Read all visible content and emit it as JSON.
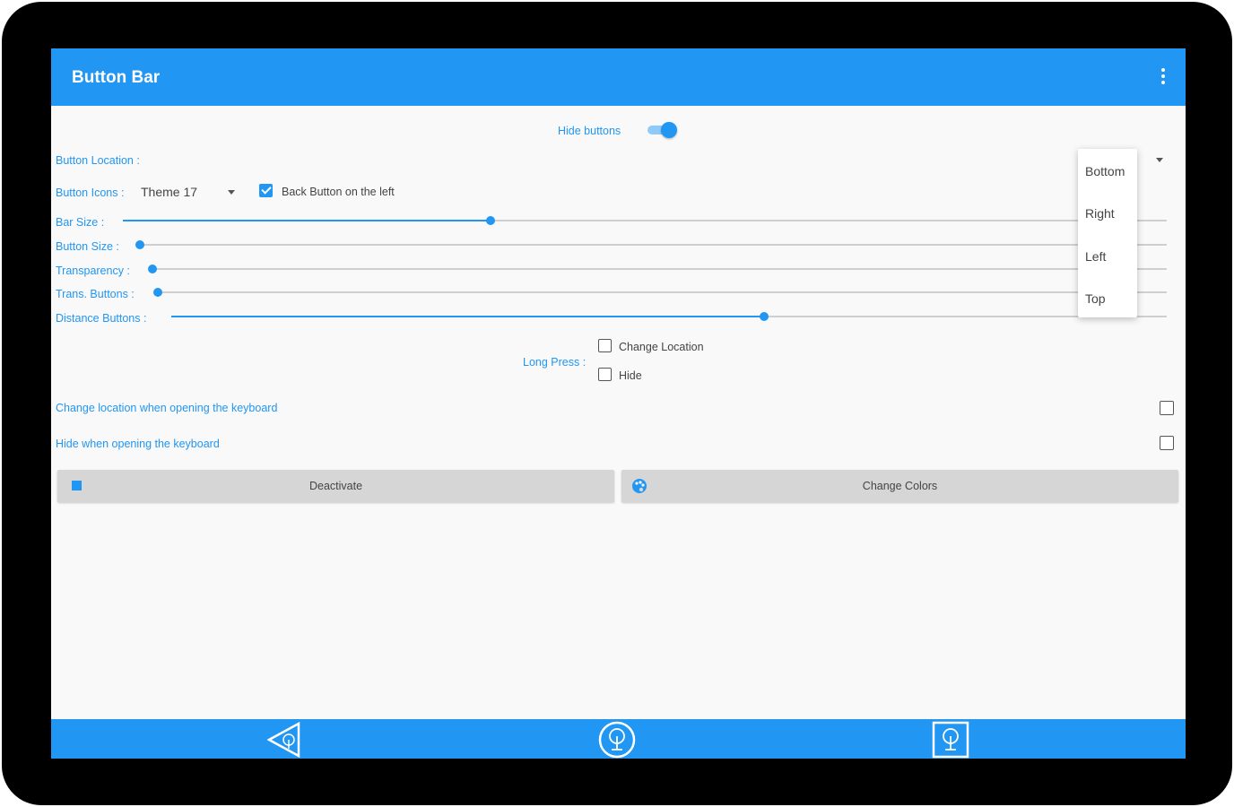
{
  "appbar": {
    "title": "Button Bar",
    "menu_icon": "overflow-menu-icon"
  },
  "hide_buttons": {
    "label": "Hide buttons",
    "enabled": true
  },
  "button_location": {
    "label": "Button Location :"
  },
  "location_menu": {
    "options": [
      "Bottom",
      "Right",
      "Left",
      "Top"
    ]
  },
  "button_icons": {
    "label": "Button Icons :",
    "value": "Theme 17"
  },
  "back_left": {
    "label": "Back Button on the left",
    "checked": true
  },
  "sliders": [
    {
      "label": "Bar Size :",
      "value_pct": 37
    },
    {
      "label": "Button Size :",
      "value_pct": 0
    },
    {
      "label": "Transparency :",
      "value_pct": 0
    },
    {
      "label": "Trans. Buttons :",
      "value_pct": 0
    },
    {
      "label": "Distance Buttons :",
      "value_pct": 66
    }
  ],
  "long_press": {
    "label": "Long Press :",
    "change_location": {
      "label": "Change Location",
      "checked": false
    },
    "hide": {
      "label": "Hide",
      "checked": false
    }
  },
  "keyboard_change": {
    "label": "Change location when opening the keyboard",
    "checked": false
  },
  "keyboard_hide": {
    "label": "Hide when opening the keyboard",
    "checked": false
  },
  "buttons": {
    "deactivate": "Deactivate",
    "change_colors": "Change Colors"
  },
  "nav": {
    "back_icon": "back-triangle-icon",
    "home_icon": "home-tree-icon",
    "recent_icon": "recent-tree-icon"
  },
  "colors": {
    "accent": "#2196f3",
    "background": "#f9f9f9",
    "button": "#d6d6d6"
  }
}
